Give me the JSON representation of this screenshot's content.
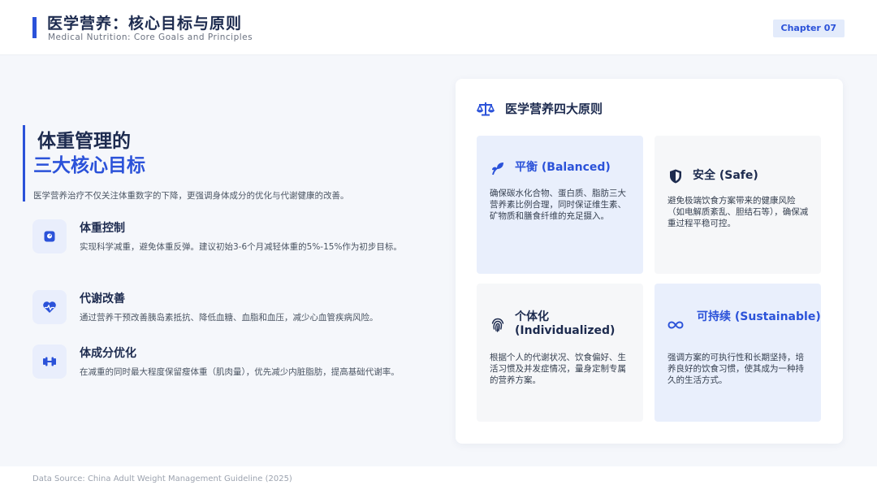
{
  "header": {
    "title_cn": "医学营养：核心目标与原则",
    "title_en": "Medical Nutrition: Core Goals and Principles",
    "chapter": "Chapter 07"
  },
  "goals": {
    "heading_line1": "体重管理的",
    "heading_line2": "三大核心目标",
    "intro": "医学营养治疗不仅关注体重数字的下降，更强调身体成分的优化与代谢健康的改善。",
    "items": [
      {
        "icon": "scale-icon",
        "title": "体重控制",
        "desc": "实现科学减重，避免体重反弹。建议初始3-6个月减轻体重的5%-15%作为初步目标。"
      },
      {
        "icon": "heartbeat-icon",
        "title": "代谢改善",
        "desc": "通过营养干预改善胰岛素抵抗、降低血糖、血脂和血压，减少心血管疾病风险。"
      },
      {
        "icon": "dumbbell-icon",
        "title": "体成分优化",
        "desc": "在减重的同时最大程度保留瘦体重（肌肉量），优先减少内脏脂肪，提高基础代谢率。"
      }
    ]
  },
  "principles": {
    "title": "医学营养四大原则",
    "cards": [
      {
        "icon": "seedling-icon",
        "title": "平衡 (Balanced)",
        "desc": "确保碳水化合物、蛋白质、脂肪三大营养素比例合理，同时保证维生素、矿物质和膳食纤维的充足摄入。"
      },
      {
        "icon": "shield-icon",
        "title": "安全 (Safe)",
        "desc": "避免极端饮食方案带来的健康风险（如电解质紊乱、胆结石等），确保减重过程平稳可控。"
      },
      {
        "icon": "fingerprint-icon",
        "title": "个体化 (Individualized)",
        "desc": "根据个人的代谢状况、饮食偏好、生活习惯及并发症情况，量身定制专属的营养方案。"
      },
      {
        "icon": "infinity-icon",
        "title": "可持续 (Sustainable)",
        "desc": "强调方案的可执行性和长期坚持，培养良好的饮食习惯，使其成为一种持久的生活方式。"
      }
    ]
  },
  "footer": {
    "source": "Data Source: China Adult Weight Management Guideline (2025)"
  },
  "colors": {
    "accent": "#2b52d9",
    "heading": "#1d2b4f",
    "card_blue": "#e9effc",
    "card_gray": "#f6f7f9"
  }
}
